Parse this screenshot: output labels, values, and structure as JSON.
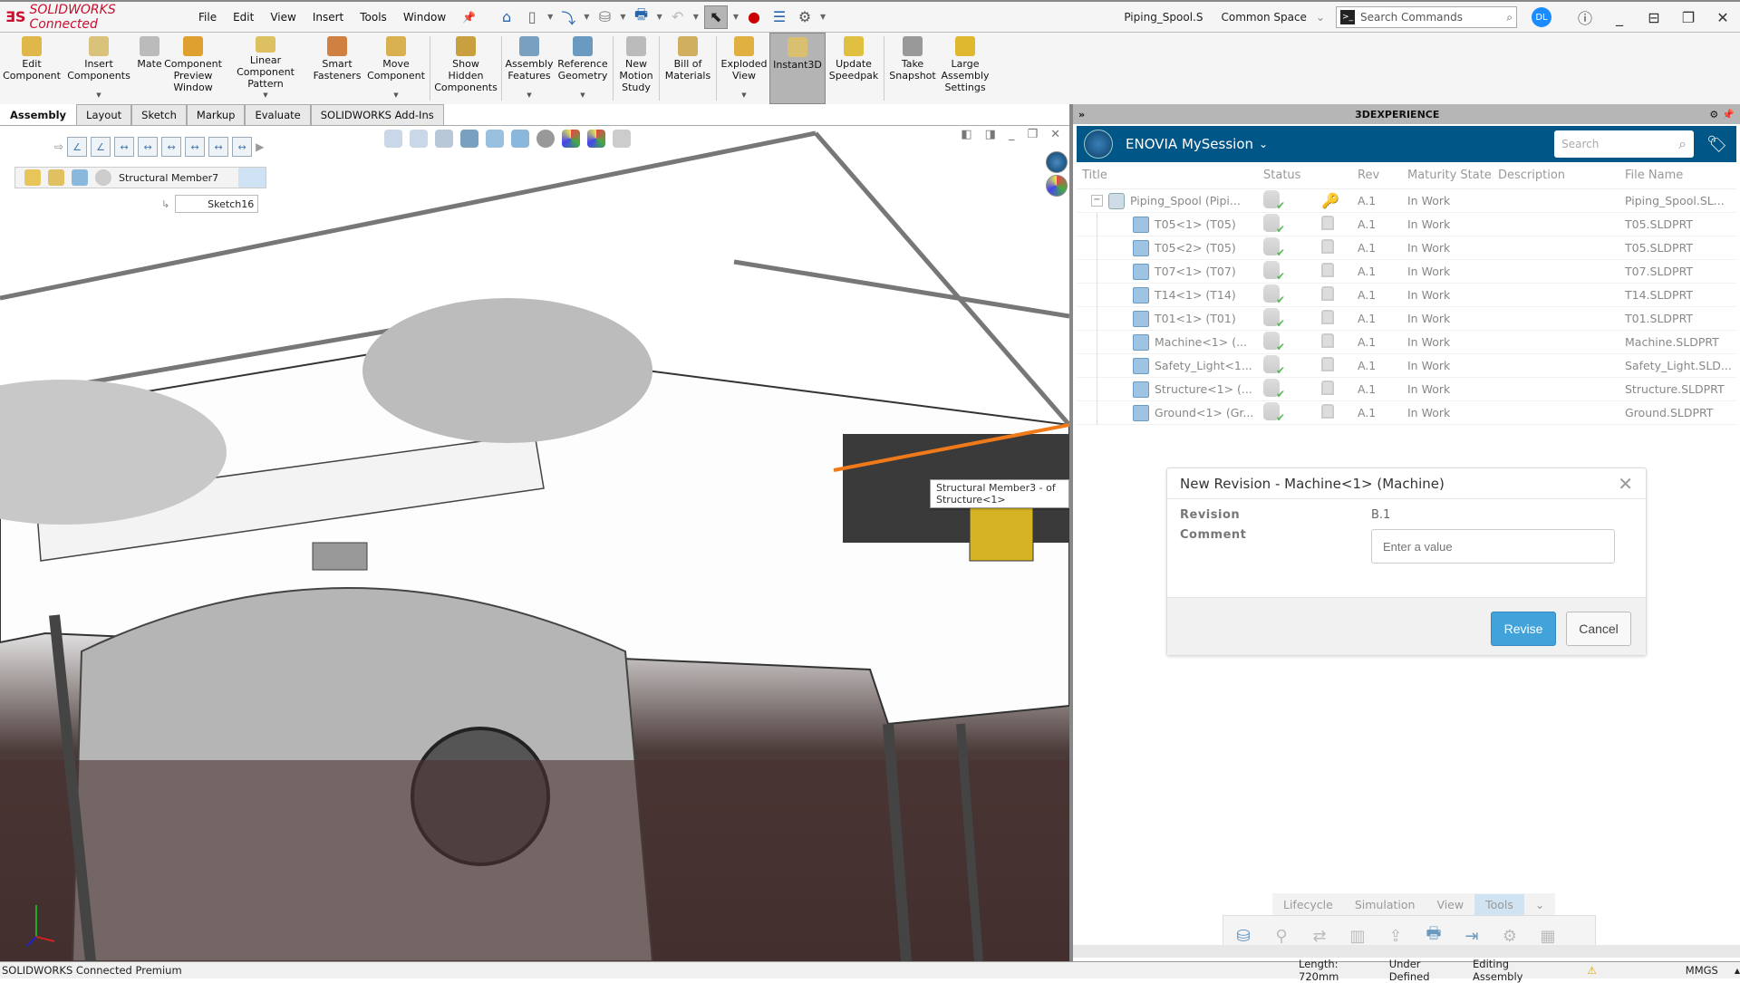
{
  "app": {
    "brand": "SOLIDWORKS Connected",
    "menu": [
      "File",
      "Edit",
      "View",
      "Insert",
      "Tools",
      "Window"
    ],
    "document_name": "Piping_Spool.S",
    "space": "Common Space",
    "search_placeholder": "Search Commands",
    "user_initials": "DL"
  },
  "ribbon": {
    "buttons": [
      {
        "label": "Edit Component"
      },
      {
        "label": "Insert Components"
      },
      {
        "label": "Mate"
      },
      {
        "label": "Component Preview Window"
      },
      {
        "label": "Linear Component Pattern"
      },
      {
        "label": "Smart Fasteners"
      },
      {
        "label": "Move Component"
      },
      {
        "label": "Show Hidden Components"
      },
      {
        "label": "Assembly Features"
      },
      {
        "label": "Reference Geometry"
      },
      {
        "label": "New Motion Study"
      },
      {
        "label": "Bill of Materials"
      },
      {
        "label": "Exploded View"
      },
      {
        "label": "Instant3D"
      },
      {
        "label": "Update Speedpak"
      },
      {
        "label": "Take Snapshot"
      },
      {
        "label": "Large Assembly Settings"
      }
    ],
    "tabs": [
      "Assembly",
      "Layout",
      "Sketch",
      "Markup",
      "Evaluate",
      "SOLIDWORKS Add-Ins"
    ],
    "active_tab": "Assembly"
  },
  "viewport": {
    "breadcrumb_label": "Structural Member7",
    "sketch_label": "Sketch16",
    "tooltip": "Structural Member3 -  of Structure<1>"
  },
  "taskpane": {
    "header": "3DEXPERIENCE",
    "app_title": "ENOVIA  MySession",
    "search_placeholder": "Search",
    "columns": [
      "Title",
      "Status",
      "Rev",
      "Maturity State",
      "Description",
      "File Name"
    ],
    "rows": [
      {
        "title": "Piping_Spool (Pipi...",
        "rev": "A.1",
        "state": "In Work",
        "description": "",
        "file": "Piping_Spool.SL...",
        "root": true
      },
      {
        "title": "T05<1> (T05)",
        "rev": "A.1",
        "state": "In Work",
        "description": "",
        "file": "T05.SLDPRT"
      },
      {
        "title": "T05<2> (T05)",
        "rev": "A.1",
        "state": "In Work",
        "description": "",
        "file": "T05.SLDPRT"
      },
      {
        "title": "T07<1> (T07)",
        "rev": "A.1",
        "state": "In Work",
        "description": "",
        "file": "T07.SLDPRT"
      },
      {
        "title": "T14<1> (T14)",
        "rev": "A.1",
        "state": "In Work",
        "description": "",
        "file": "T14.SLDPRT"
      },
      {
        "title": "T01<1> (T01)",
        "rev": "A.1",
        "state": "In Work",
        "description": "",
        "file": "T01.SLDPRT"
      },
      {
        "title": "Machine<1> (...",
        "rev": "A.1",
        "state": "In Work",
        "description": "",
        "file": "Machine.SLDPRT"
      },
      {
        "title": "Safety_Light<1...",
        "rev": "A.1",
        "state": "In Work",
        "description": "",
        "file": "Safety_Light.SLD..."
      },
      {
        "title": "Structure<1> (...",
        "rev": "A.1",
        "state": "In Work",
        "description": "",
        "file": "Structure.SLDPRT"
      },
      {
        "title": "Ground<1> (Gr...",
        "rev": "A.1",
        "state": "In Work",
        "description": "",
        "file": "Ground.SLDPRT"
      }
    ],
    "bottom_tabs": [
      "Lifecycle",
      "Simulation",
      "View",
      "Tools"
    ],
    "active_bottom_tab": "Tools"
  },
  "dialog": {
    "title": "New Revision - Machine<1> (Machine)",
    "revision_label": "Revision",
    "revision_value": "B.1",
    "comment_label": "Comment",
    "comment_placeholder": "Enter a value",
    "revise_label": "Revise",
    "cancel_label": "Cancel"
  },
  "statusbar": {
    "product": "SOLIDWORKS Connected Premium",
    "length": "Length: 720mm",
    "definition": "Under Defined",
    "mode": "Editing Assembly",
    "units": "MMGS"
  },
  "colors": {
    "brand_red": "#c8102e",
    "enovia_blue": "#005686",
    "revise_blue": "#42a2da"
  }
}
